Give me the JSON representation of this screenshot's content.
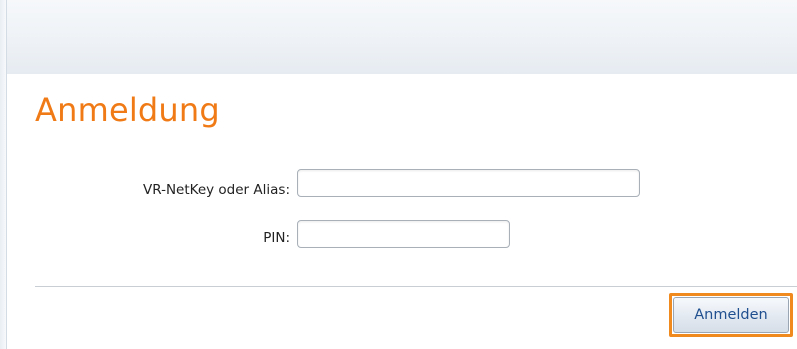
{
  "page": {
    "title": "Anmeldung"
  },
  "form": {
    "username_label": "VR-NetKey oder Alias:",
    "username_value": "",
    "pin_label": "PIN:",
    "pin_value": "",
    "submit_label": "Anmelden"
  },
  "colors": {
    "title": "#f07b16",
    "focus_ring": "#f08a1e",
    "button_text": "#1f4f8f"
  }
}
